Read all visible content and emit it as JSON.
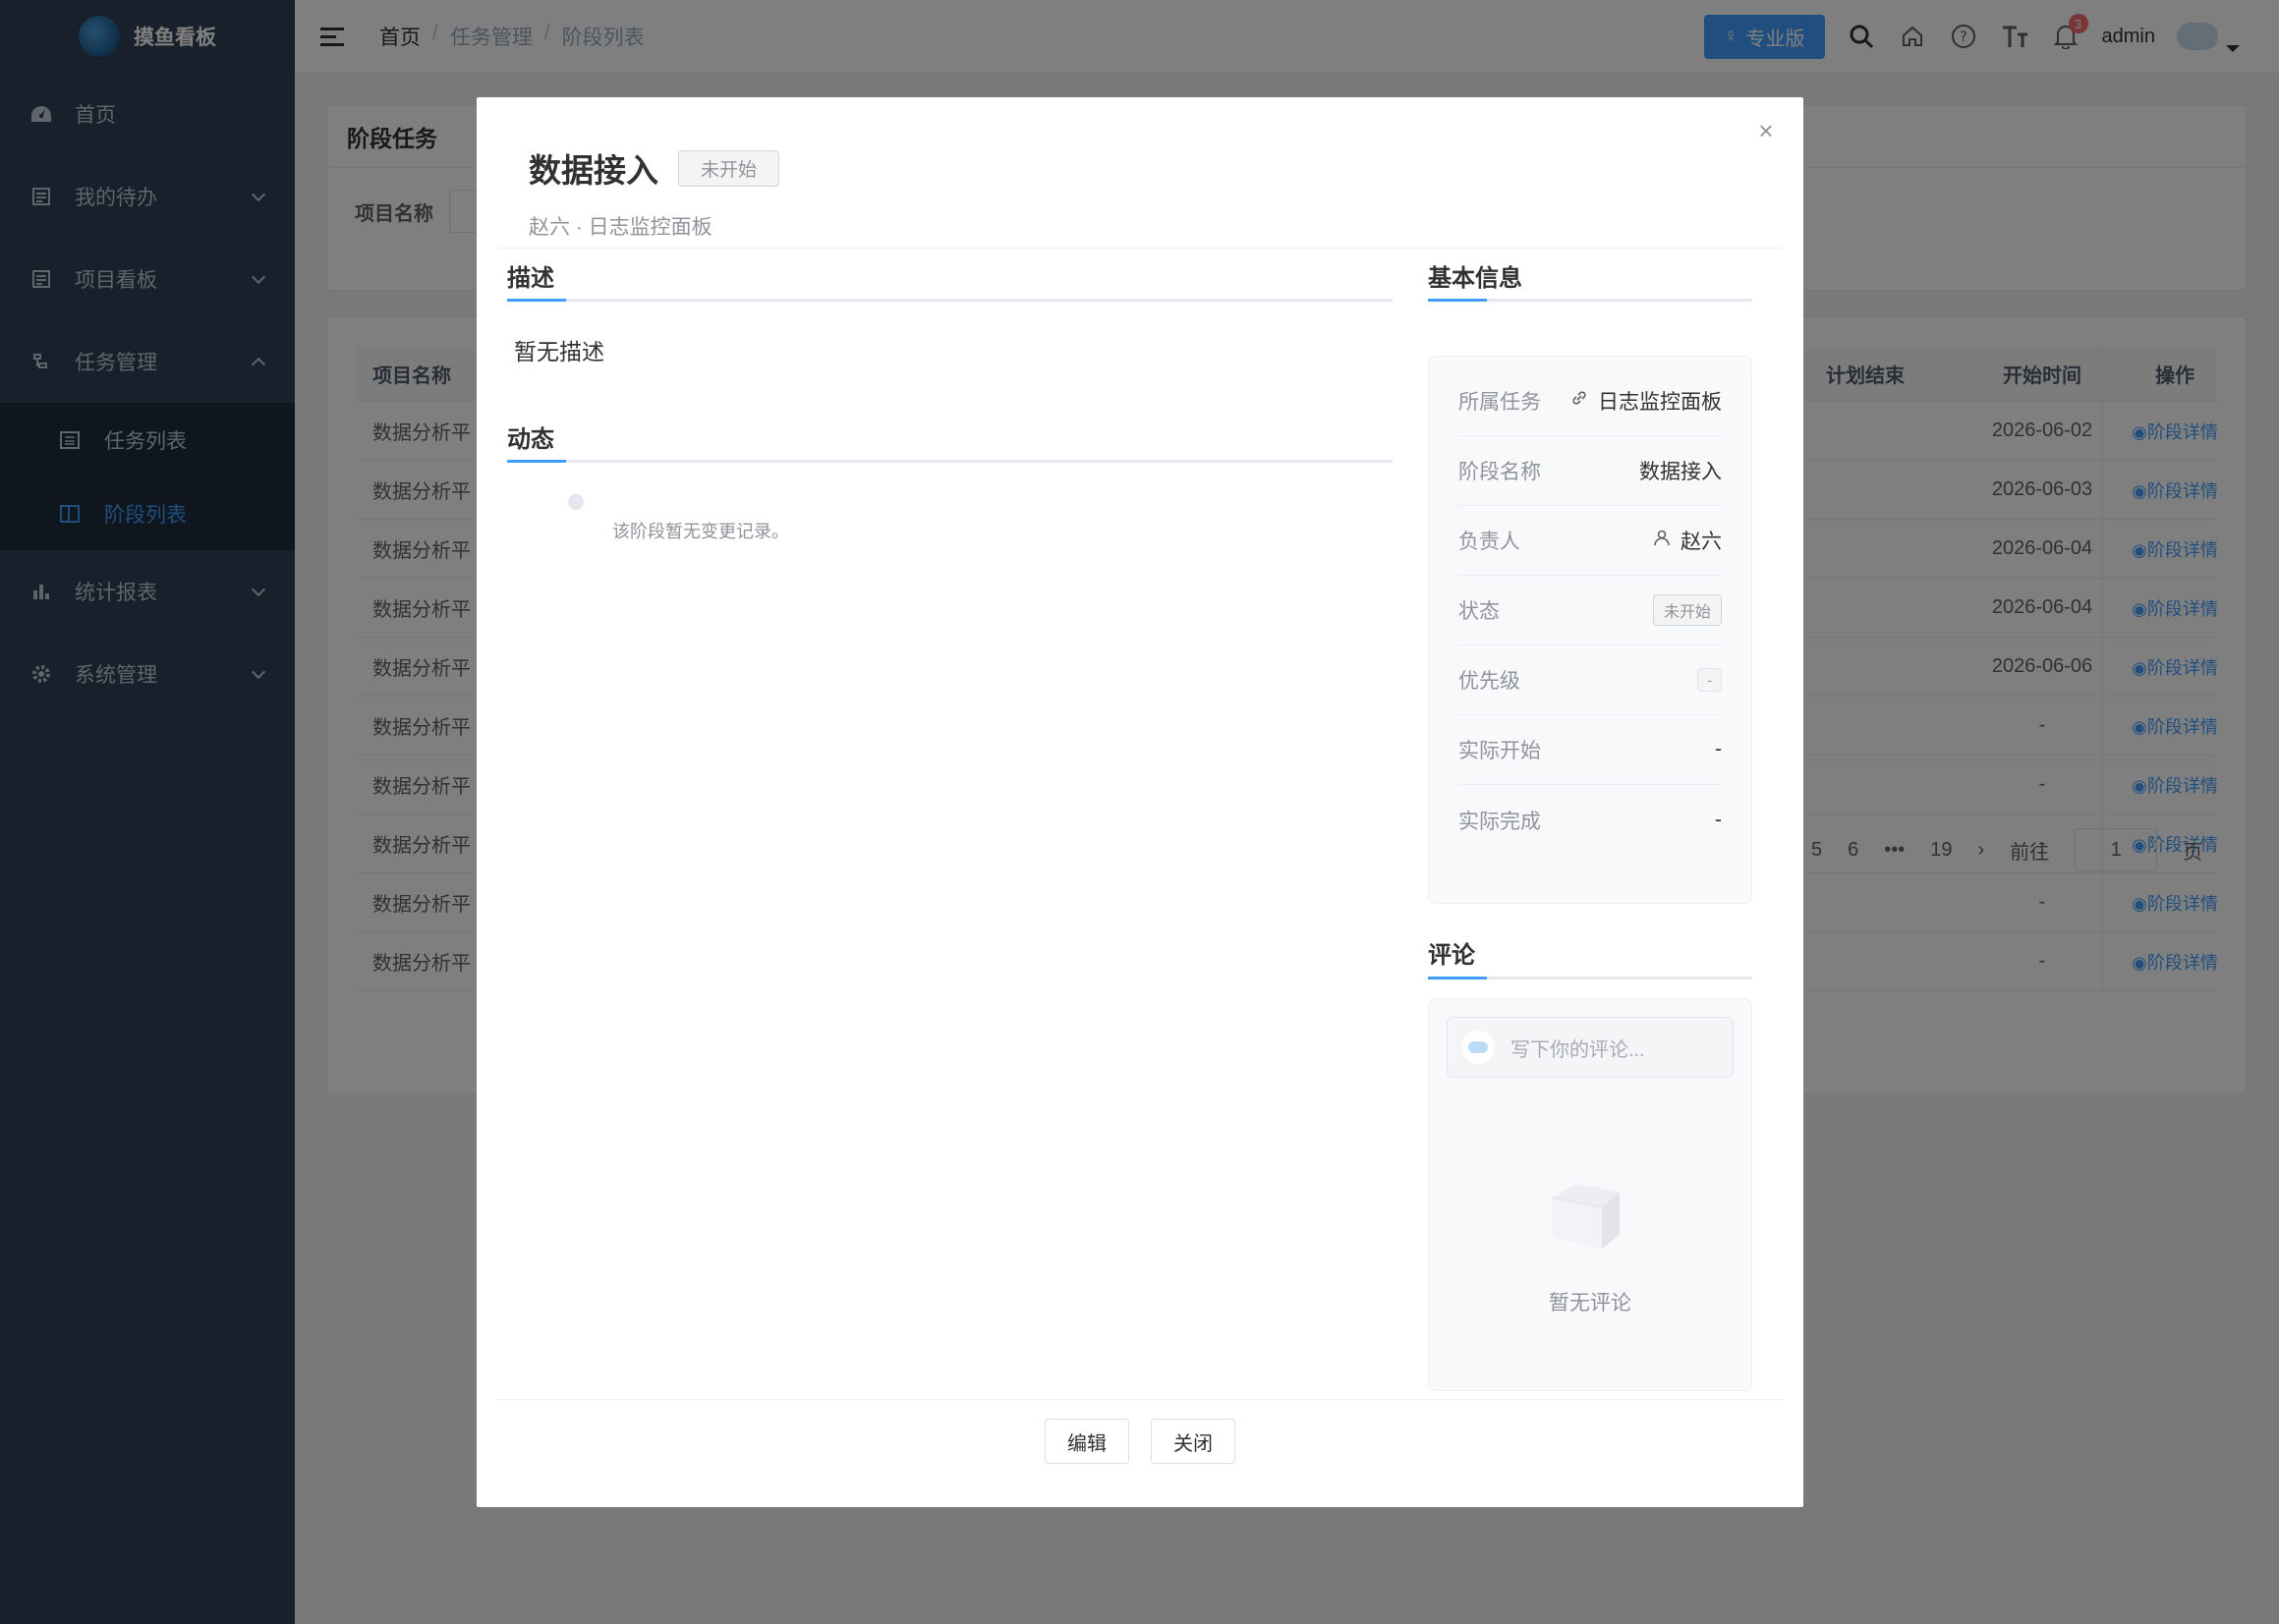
{
  "app": {
    "title": "摸鱼看板"
  },
  "sidebar": {
    "items": [
      {
        "label": "首页",
        "icon": "dashboard-icon"
      },
      {
        "label": "我的待办",
        "icon": "todo-icon"
      },
      {
        "label": "项目看板",
        "icon": "board-icon"
      },
      {
        "label": "任务管理",
        "icon": "tree-icon"
      },
      {
        "label": "统计报表",
        "icon": "chart-icon"
      },
      {
        "label": "系统管理",
        "icon": "gear-icon"
      }
    ],
    "sub_items": [
      {
        "label": "任务列表",
        "icon": "list-icon"
      },
      {
        "label": "阶段列表",
        "icon": "columns-icon"
      }
    ]
  },
  "header": {
    "breadcrumb": [
      "首页",
      "任务管理",
      "阶段列表"
    ],
    "pro_label": "专业版",
    "notification_count": "3",
    "user": "admin"
  },
  "page": {
    "card_title": "阶段任务",
    "filter_label": "项目名称",
    "table": {
      "headers": {
        "name": "项目名称",
        "plan_end": "计划结束",
        "start": "开始时间",
        "op": "操作"
      },
      "rows": [
        {
          "name": "数据分析平",
          "start": "2026-06-02",
          "op": "阶段详情"
        },
        {
          "name": "数据分析平",
          "start": "2026-06-03",
          "op": "阶段详情"
        },
        {
          "name": "数据分析平",
          "start": "2026-06-04",
          "op": "阶段详情"
        },
        {
          "name": "数据分析平",
          "start": "2026-06-04",
          "op": "阶段详情"
        },
        {
          "name": "数据分析平",
          "start": "2026-06-06",
          "op": "阶段详情"
        },
        {
          "name": "数据分析平",
          "start": "-",
          "op": "阶段详情"
        },
        {
          "name": "数据分析平",
          "start": "-",
          "op": "阶段详情"
        },
        {
          "name": "数据分析平",
          "start": "-",
          "op": "阶段详情"
        },
        {
          "name": "数据分析平",
          "start": "-",
          "op": "阶段详情"
        },
        {
          "name": "数据分析平",
          "start": "-",
          "op": "阶段详情"
        }
      ]
    },
    "pager": {
      "p5": "5",
      "p6": "6",
      "ellipsis": "•••",
      "last": "19",
      "goto": "前往",
      "goto_value": "1",
      "page_unit": "页"
    }
  },
  "modal": {
    "title": "数据接入",
    "status_tag": "未开始",
    "subtitle": "赵六 · 日志监控面板",
    "sections": {
      "desc": "描述",
      "activity": "动态",
      "basic": "基本信息",
      "comments": "评论"
    },
    "description": "暂无描述",
    "activity_empty": "该阶段暂无变更记录。",
    "info": {
      "task_label": "所属任务",
      "task_value": "日志监控面板",
      "stage_label": "阶段名称",
      "stage_value": "数据接入",
      "owner_label": "负责人",
      "owner_value": "赵六",
      "status_label": "状态",
      "status_value": "未开始",
      "priority_label": "优先级",
      "priority_value": "-",
      "actual_start_label": "实际开始",
      "actual_start_value": "-",
      "actual_end_label": "实际完成",
      "actual_end_value": "-"
    },
    "comment_placeholder": "写下你的评论...",
    "comments_empty": "暂无评论",
    "buttons": {
      "edit": "编辑",
      "close": "关闭"
    }
  },
  "colors": {
    "accent": "#409eff",
    "sidebar_bg": "#304156",
    "submenu_bg": "#1f2d3d"
  }
}
